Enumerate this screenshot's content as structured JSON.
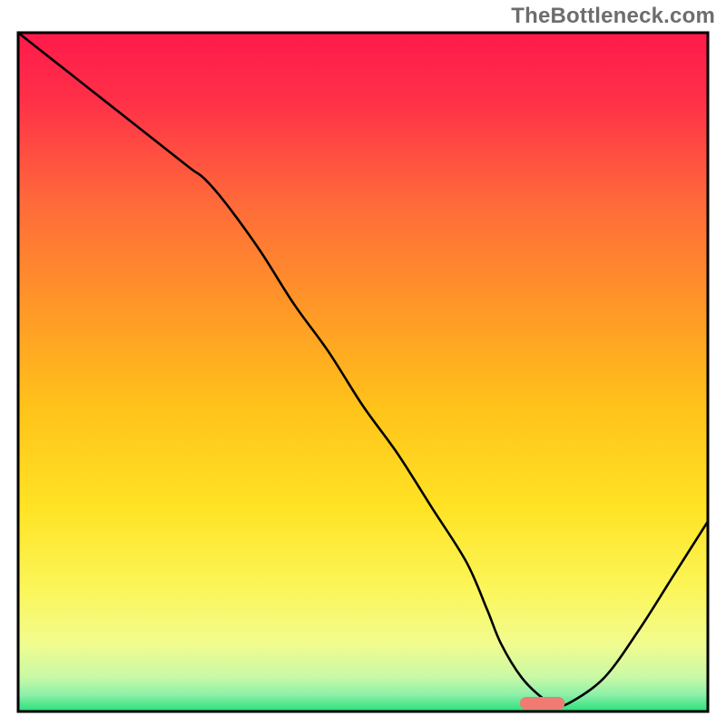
{
  "watermark": "TheBottleneck.com",
  "chart_data": {
    "type": "line",
    "title": "",
    "xlabel": "",
    "ylabel": "",
    "xlim": [
      0,
      100
    ],
    "ylim": [
      0,
      100
    ],
    "series": [
      {
        "name": "bottleneck-curve",
        "x": [
          0,
          5,
          10,
          15,
          20,
          25,
          27,
          30,
          35,
          40,
          45,
          50,
          55,
          60,
          65,
          68,
          70,
          73,
          76,
          78,
          80,
          85,
          90,
          95,
          100
        ],
        "y": [
          100,
          96,
          92,
          88,
          84,
          80,
          78.5,
          75,
          68,
          60,
          53,
          45,
          38,
          30,
          22,
          15,
          10,
          5,
          2,
          1,
          1.3,
          5,
          12,
          20,
          28
        ]
      }
    ],
    "marker": {
      "name": "optimal-range",
      "x_center": 76,
      "width_x": 6.5,
      "color": "#ef7b72"
    },
    "background_gradient": {
      "stops": [
        {
          "offset": 0.0,
          "color": "#ff1a4b"
        },
        {
          "offset": 0.1,
          "color": "#ff3048"
        },
        {
          "offset": 0.25,
          "color": "#ff6a3a"
        },
        {
          "offset": 0.4,
          "color": "#ff9628"
        },
        {
          "offset": 0.55,
          "color": "#ffc21a"
        },
        {
          "offset": 0.7,
          "color": "#ffe324"
        },
        {
          "offset": 0.82,
          "color": "#fbf65a"
        },
        {
          "offset": 0.9,
          "color": "#f1fc8e"
        },
        {
          "offset": 0.95,
          "color": "#c8f9a6"
        },
        {
          "offset": 0.975,
          "color": "#8ef0a8"
        },
        {
          "offset": 1.0,
          "color": "#28e07a"
        }
      ]
    },
    "border_color": "#000000",
    "curve_stroke": "#000000",
    "curve_stroke_width": 2.6
  }
}
